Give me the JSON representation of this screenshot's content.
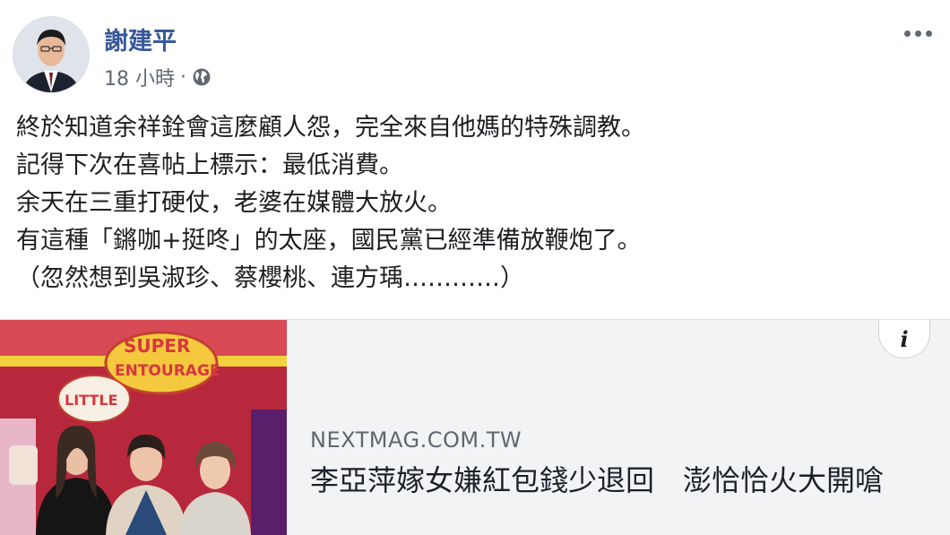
{
  "post": {
    "author": "謝建平",
    "time": "18 小時",
    "separator": "·",
    "privacy_icon": "globe-icon",
    "more_icon": "more-options-icon",
    "lines": [
      "終於知道余祥銓會這麼顧人怨，完全來自他媽的特殊調教。",
      "記得下次在喜帖上標示：最低消費。",
      "余天在三重打硬仗，老婆在媒體大放火。",
      "有這種「鏘咖+挺咚」的太座，國民黨已經準備放鞭炮了。",
      "（忽然想到吳淑珍、蔡櫻桃、連方瑀…………）"
    ]
  },
  "link_card": {
    "image_text_top": "SUPER",
    "image_text_mid": "ENTOURAGE",
    "image_text_small": "LITTLE",
    "info_icon": "info-icon",
    "info_glyph": "i",
    "domain": "NEXTMAG.COM.TW",
    "headline": "李亞萍嫁女嫌紅包錢少退回　澎恰恰火大開嗆"
  },
  "colors": {
    "author": "#385898",
    "meta": "#616770",
    "card_bg": "#f2f3f5"
  }
}
